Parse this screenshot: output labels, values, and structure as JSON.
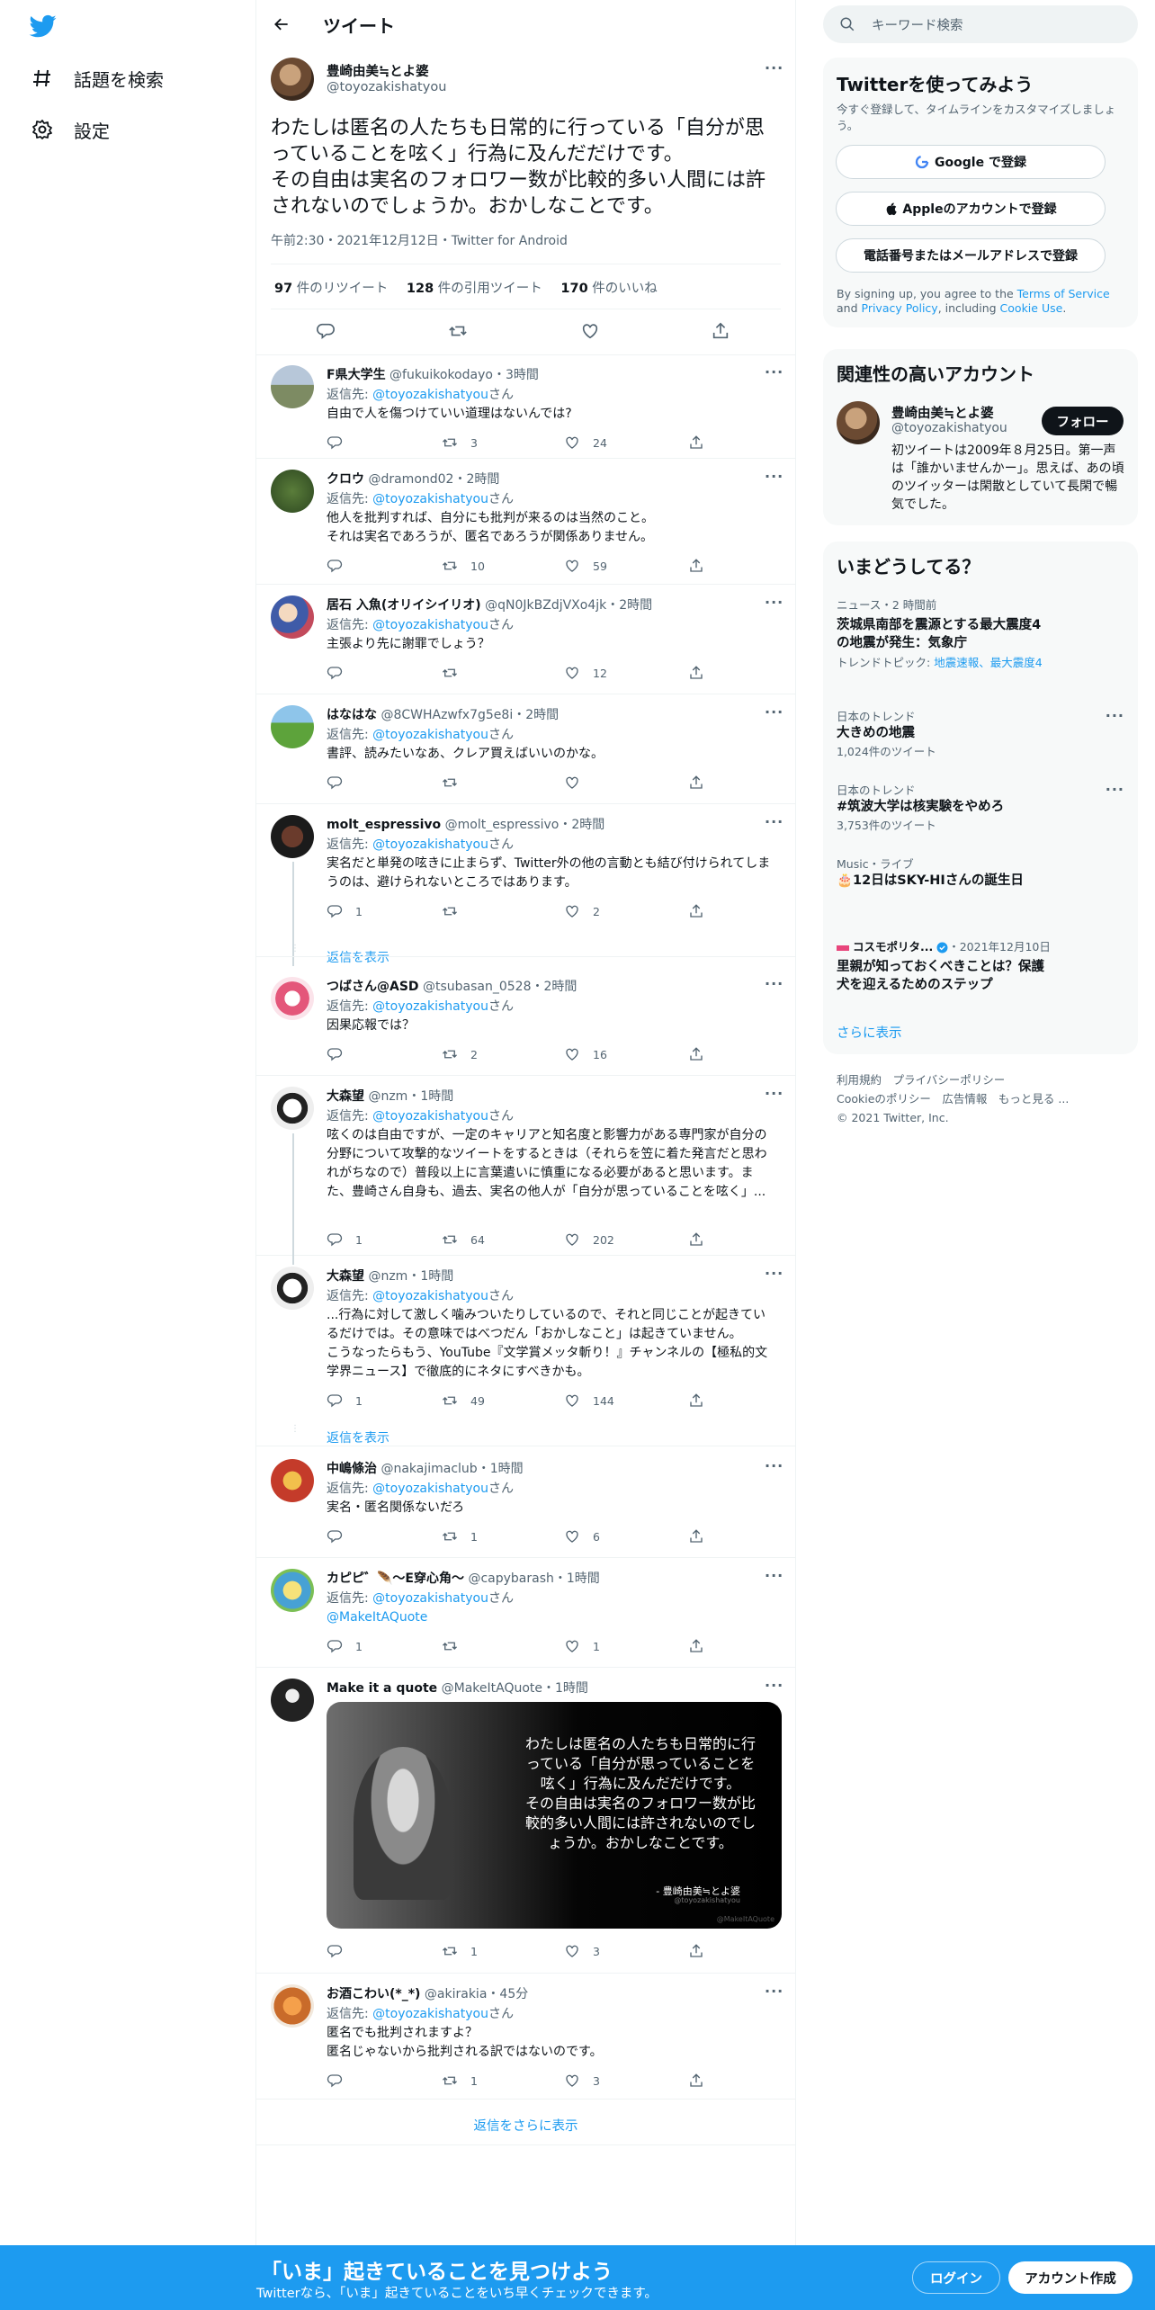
{
  "nav": {
    "explore_label": "話題を検索",
    "settings_label": "設定"
  },
  "header": {
    "title": "ツイート"
  },
  "main_tweet": {
    "name": "豊崎由美≒とよ婆",
    "handle": "@toyozakishatyou",
    "text": "わたしは匿名の人たちも日常的に行っている「自分が思っていることを呟く」行為に及んだだけです。\nその自由は実名のフォロワー数が比較的多い人間には許されないのでしょうか。おかしなことです。",
    "timestamp": "午前2:30・2021年12月12日・Twitter for Android",
    "retweets": "97",
    "retweets_label": "件のリツイート",
    "quotes": "128",
    "quotes_label": "件の引用ツイート",
    "likes": "170",
    "likes_label": "件のいいね"
  },
  "replying_prefix": "返信先: ",
  "replying_handle": "@toyozakishatyou",
  "replying_suffix": "さん",
  "show_replies_label": "返信を表示",
  "show_more_replies_label": "返信をさらに表示",
  "replies": [
    {
      "name": "F県大学生",
      "handle": "@fukuikokodayo",
      "time": "3時間",
      "text": "自由で人を傷つけていい道理はないんでは?",
      "replies": "",
      "retweets": "3",
      "likes": "24"
    },
    {
      "name": "クロウ",
      "handle": "@dramond02",
      "time": "2時間",
      "text": "他人を批判すれば、自分にも批判が来るのは当然のこと。\nそれは実名であろうが、匿名であろうが関係ありません。",
      "replies": "",
      "retweets": "10",
      "likes": "59"
    },
    {
      "name": "居石 入魚(オリイシイリオ)",
      "handle": "@qN0JkBZdjVXo4jk",
      "time": "2時間",
      "text": "主張より先に謝罪でしょう？",
      "replies": "",
      "retweets": "",
      "likes": "12"
    },
    {
      "name": "はなはな",
      "handle": "@8CWHAzwfx7g5e8i",
      "time": "2時間",
      "text": "書評、読みたいなあ、クレア買えばいいのかな。",
      "replies": "",
      "retweets": "",
      "likes": ""
    },
    {
      "name": "molt_espressivo",
      "handle": "@molt_espressivo",
      "time": "2時間",
      "text": "実名だと単発の呟きに止まらず、Twitter外の他の言動とも結び付けられてしまうのは、避けられないところではあります。",
      "replies": "1",
      "retweets": "",
      "likes": "2"
    },
    {
      "name": "つばさん@ASD",
      "handle": "@tsubasan_0528",
      "time": "2時間",
      "text": "因果応報では？",
      "replies": "",
      "retweets": "2",
      "likes": "16"
    },
    {
      "name": "大森望",
      "handle": "@nzm",
      "time": "1時間",
      "text": "呟くのは自由ですが、一定のキャリアと知名度と影響力がある専門家が自分の分野について攻撃的なツイートをするときは（それらを笠に着た発言だと思われがちなので）普段以上に言葉遣いに慎重になる必要があると思います。また、豊崎さん自身も、過去、実名の他人が「自分が思っていることを呟く」...",
      "replies": "1",
      "retweets": "64",
      "likes": "202"
    },
    {
      "name": "大森望",
      "handle": "@nzm",
      "time": "1時間",
      "text": "...行為に対して激しく噛みついたりしているので、それと同じことが起きているだけでは。その意味ではべつだん「おかしなこと」は起きていません。\nこうなったらもう、YouTube『文学賞メッタ斬り！』チャンネルの【極私的文学界ニュース】で徹底的にネタにすべきかも。",
      "replies": "1",
      "retweets": "49",
      "likes": "144"
    },
    {
      "name": "中嶋條治",
      "handle": "@nakajimaclub",
      "time": "1時間",
      "text": "実名・匿名関係ないだろ",
      "replies": "",
      "retweets": "1",
      "likes": "6"
    },
    {
      "name": "カピピ゛🪶〜E穿心角〜",
      "handle": "@capybarash",
      "time": "1時間",
      "text": "@MakeItAQuote",
      "replies": "1",
      "retweets": "",
      "likes": "1"
    },
    {
      "name": "Make it a quote",
      "handle": "@MakeItAQuote",
      "time": "1時間",
      "text": "",
      "replies": "",
      "retweets": "1",
      "likes": "3"
    },
    {
      "name": "お酒こわい(*_*)",
      "handle": "@akirakia",
      "time": "45分",
      "text": "匿名でも批判されますよ？\n匿名じゃないから批判される訳ではないのです。",
      "replies": "",
      "retweets": "1",
      "likes": "3"
    }
  ],
  "quote_image": {
    "text": "わたしは匿名の人たちも日常的に行っている「自分が思っていることを呟く」行為に及んだだけです。\nその自由は実名のフォロワー数が比較的多い人間には許されないのでしょうか。おかしなことです。",
    "author": "- 豊崎由美≒とよ婆",
    "author_handle": "@toyozakishatyou",
    "watermark": "@MakeItAQuote"
  },
  "search": {
    "placeholder": "キーワード検索"
  },
  "signup": {
    "title": "Twitterを使ってみよう",
    "subtitle": "今すぐ登録して、タイムラインをカスタマイズしましょう。",
    "google": "Google で登録",
    "apple": "Appleのアカウントで登録",
    "phone": "電話番号またはメールアドレスで登録",
    "terms_prefix": "By signing up, you agree to the ",
    "terms_link": "Terms of Service",
    "terms_and": " and ",
    "privacy_link": "Privacy Policy",
    "terms_including": ", including ",
    "cookie_link": "Cookie Use",
    "terms_end": "."
  },
  "related": {
    "title": "関連性の高いアカウント",
    "name": "豊崎由美≒とよ婆",
    "handle": "@toyozakishatyou",
    "follow": "フォロー",
    "bio": "初ツイートは2009年８月25日。第一声は「誰かいませんかー」。思えば、あの頃のツイッターは閑散としていて長閑で暢気でした。"
  },
  "trends": {
    "title": "いまどうしてる？",
    "items": [
      {
        "category": "ニュース・2 時間前",
        "name": "茨城県南部を震源とする最大震度4の地震が発生：気象庁",
        "topic_prefix": "トレンドトピック: ",
        "topic_links": "地震速報、最大震度4",
        "count": ""
      },
      {
        "category": "日本のトレンド",
        "name": "大きめの地震",
        "count": "1,024件のツイート"
      },
      {
        "category": "日本のトレンド",
        "name": "#筑波大学は核実験をやめろ",
        "count": "3,753件のツイート"
      },
      {
        "category": "Music・ライブ",
        "name": "🎂12日はSKY-HIさんの誕生日",
        "count": ""
      },
      {
        "category": "コスモポリタ...",
        "date": "・2021年12月10日",
        "name": "里親が知っておくべきことは？保護犬を迎えるためのステップ",
        "count": ""
      }
    ],
    "show_more": "さらに表示"
  },
  "footer": {
    "line1": "利用規約　プライバシーポリシー",
    "line2": "Cookieのポリシー　広告情報　もっと見る ...",
    "line3": "© 2021 Twitter, Inc."
  },
  "bottom_bar": {
    "title": "「いま」起きていることを見つけよう",
    "subtitle": "Twitterなら、「いま」起きていることをいち早くチェックできます。",
    "login": "ログイン",
    "signup": "アカウント作成"
  },
  "colors": {
    "accent": "#1d9bf0",
    "text": "#0f1419",
    "secondary": "#536471"
  },
  "icons": [
    "twitter-logo-icon",
    "hashtag-icon",
    "gear-icon",
    "back-arrow-icon",
    "reply-icon",
    "retweet-icon",
    "like-icon",
    "share-icon",
    "more-icon",
    "search-icon",
    "verified-icon"
  ]
}
